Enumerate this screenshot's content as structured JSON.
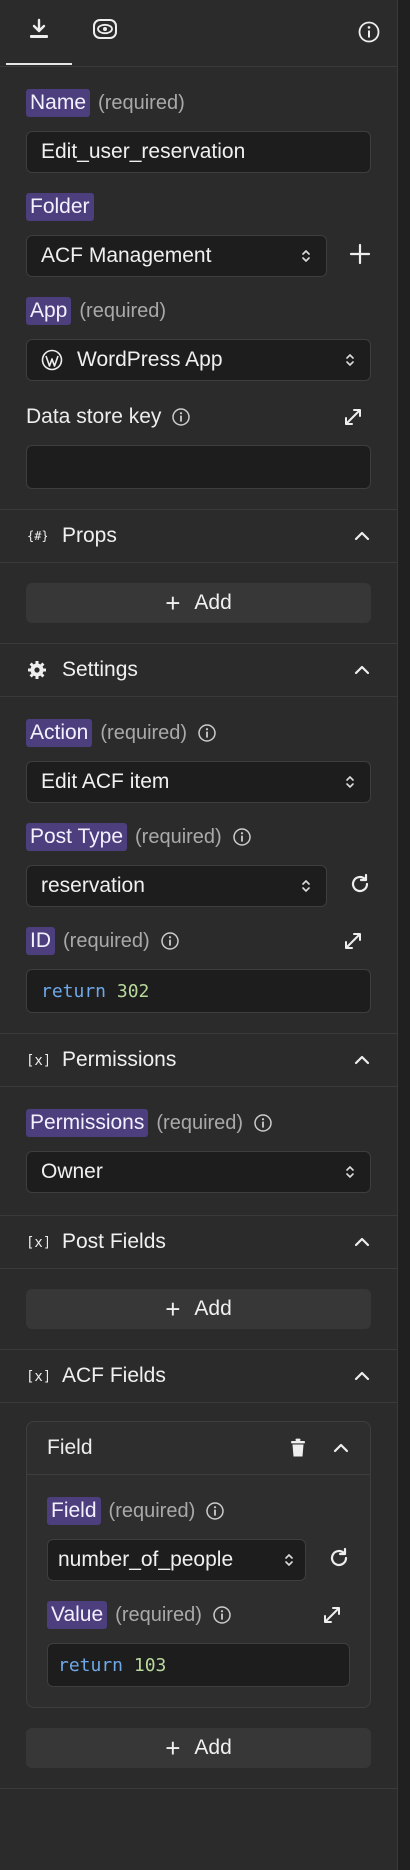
{
  "name": {
    "label": "Name",
    "required": "(required)",
    "value": "Edit_user_reservation"
  },
  "folder": {
    "label": "Folder",
    "value": "ACF Management"
  },
  "app": {
    "label": "App",
    "required": "(required)",
    "value": "WordPress App"
  },
  "datastore": {
    "label": "Data store key",
    "value": ""
  },
  "props": {
    "title": "Props",
    "add_label": "Add"
  },
  "settings": {
    "title": "Settings",
    "action": {
      "label": "Action",
      "required": "(required)",
      "value": "Edit ACF item"
    },
    "post_type": {
      "label": "Post Type",
      "required": "(required)",
      "value": "reservation"
    },
    "id": {
      "label": "ID",
      "required": "(required)",
      "code_kw": "return",
      "code_val": "302"
    }
  },
  "permissions": {
    "title": "Permissions",
    "field": {
      "label": "Permissions",
      "required": "(required)",
      "value": "Owner"
    }
  },
  "post_fields": {
    "title": "Post Fields",
    "add_label": "Add"
  },
  "acf_fields": {
    "title": "ACF Fields",
    "card_title": "Field",
    "field": {
      "label": "Field",
      "required": "(required)",
      "value": "number_of_people"
    },
    "value": {
      "label": "Value",
      "required": "(required)",
      "code_kw": "return",
      "code_val": "103"
    },
    "add_label": "Add"
  },
  "colors": {
    "panel": "#2b2b2b",
    "input": "#1d1d1d",
    "highlight": "#4d3e7e",
    "code_keyword": "#6ea8e8",
    "code_number": "#b8d89c"
  },
  "icons": [
    "download-icon",
    "preview-icon",
    "info-icon",
    "chevron-up-icon",
    "plus-icon",
    "gear-icon",
    "braces-icon",
    "variable-icon",
    "refresh-icon",
    "expand-icon",
    "trash-icon",
    "wordpress-icon",
    "select-caret-icon"
  ]
}
